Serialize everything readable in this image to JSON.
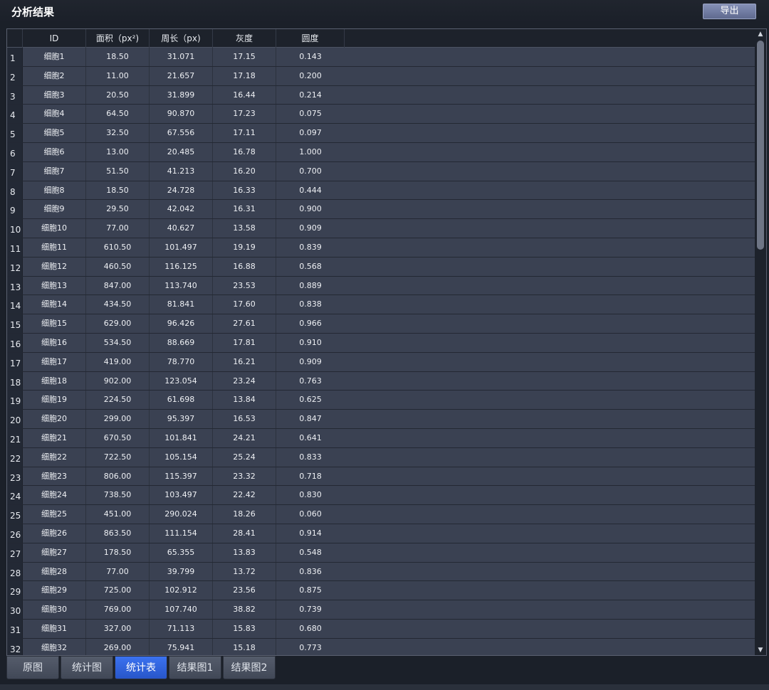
{
  "window": {
    "title": "分析结果"
  },
  "toolbar": {
    "export_label": "导出"
  },
  "table": {
    "columns": [
      "ID",
      "面积（px²)",
      "周长（px)",
      "灰度",
      "圆度"
    ],
    "rows": [
      {
        "n": "1",
        "id": "细胞1",
        "area": "18.50",
        "perimeter": "31.071",
        "gray": "17.15",
        "roundness": "0.143"
      },
      {
        "n": "2",
        "id": "细胞2",
        "area": "11.00",
        "perimeter": "21.657",
        "gray": "17.18",
        "roundness": "0.200"
      },
      {
        "n": "3",
        "id": "细胞3",
        "area": "20.50",
        "perimeter": "31.899",
        "gray": "16.44",
        "roundness": "0.214"
      },
      {
        "n": "4",
        "id": "细胞4",
        "area": "64.50",
        "perimeter": "90.870",
        "gray": "17.23",
        "roundness": "0.075"
      },
      {
        "n": "5",
        "id": "细胞5",
        "area": "32.50",
        "perimeter": "67.556",
        "gray": "17.11",
        "roundness": "0.097"
      },
      {
        "n": "6",
        "id": "细胞6",
        "area": "13.00",
        "perimeter": "20.485",
        "gray": "16.78",
        "roundness": "1.000"
      },
      {
        "n": "7",
        "id": "细胞7",
        "area": "51.50",
        "perimeter": "41.213",
        "gray": "16.20",
        "roundness": "0.700"
      },
      {
        "n": "8",
        "id": "细胞8",
        "area": "18.50",
        "perimeter": "24.728",
        "gray": "16.33",
        "roundness": "0.444"
      },
      {
        "n": "9",
        "id": "细胞9",
        "area": "29.50",
        "perimeter": "42.042",
        "gray": "16.31",
        "roundness": "0.900"
      },
      {
        "n": "10",
        "id": "细胞10",
        "area": "77.00",
        "perimeter": "40.627",
        "gray": "13.58",
        "roundness": "0.909"
      },
      {
        "n": "11",
        "id": "细胞11",
        "area": "610.50",
        "perimeter": "101.497",
        "gray": "19.19",
        "roundness": "0.839"
      },
      {
        "n": "12",
        "id": "细胞12",
        "area": "460.50",
        "perimeter": "116.125",
        "gray": "16.88",
        "roundness": "0.568"
      },
      {
        "n": "13",
        "id": "细胞13",
        "area": "847.00",
        "perimeter": "113.740",
        "gray": "23.53",
        "roundness": "0.889"
      },
      {
        "n": "14",
        "id": "细胞14",
        "area": "434.50",
        "perimeter": "81.841",
        "gray": "17.60",
        "roundness": "0.838"
      },
      {
        "n": "15",
        "id": "细胞15",
        "area": "629.00",
        "perimeter": "96.426",
        "gray": "27.61",
        "roundness": "0.966"
      },
      {
        "n": "16",
        "id": "细胞16",
        "area": "534.50",
        "perimeter": "88.669",
        "gray": "17.81",
        "roundness": "0.910"
      },
      {
        "n": "17",
        "id": "细胞17",
        "area": "419.00",
        "perimeter": "78.770",
        "gray": "16.21",
        "roundness": "0.909"
      },
      {
        "n": "18",
        "id": "细胞18",
        "area": "902.00",
        "perimeter": "123.054",
        "gray": "23.24",
        "roundness": "0.763"
      },
      {
        "n": "19",
        "id": "细胞19",
        "area": "224.50",
        "perimeter": "61.698",
        "gray": "13.84",
        "roundness": "0.625"
      },
      {
        "n": "20",
        "id": "细胞20",
        "area": "299.00",
        "perimeter": "95.397",
        "gray": "16.53",
        "roundness": "0.847"
      },
      {
        "n": "21",
        "id": "细胞21",
        "area": "670.50",
        "perimeter": "101.841",
        "gray": "24.21",
        "roundness": "0.641"
      },
      {
        "n": "22",
        "id": "细胞22",
        "area": "722.50",
        "perimeter": "105.154",
        "gray": "25.24",
        "roundness": "0.833"
      },
      {
        "n": "23",
        "id": "细胞23",
        "area": "806.00",
        "perimeter": "115.397",
        "gray": "23.32",
        "roundness": "0.718"
      },
      {
        "n": "24",
        "id": "细胞24",
        "area": "738.50",
        "perimeter": "103.497",
        "gray": "22.42",
        "roundness": "0.830"
      },
      {
        "n": "25",
        "id": "细胞25",
        "area": "451.00",
        "perimeter": "290.024",
        "gray": "18.26",
        "roundness": "0.060"
      },
      {
        "n": "26",
        "id": "细胞26",
        "area": "863.50",
        "perimeter": "111.154",
        "gray": "28.41",
        "roundness": "0.914"
      },
      {
        "n": "27",
        "id": "细胞27",
        "area": "178.50",
        "perimeter": "65.355",
        "gray": "13.83",
        "roundness": "0.548"
      },
      {
        "n": "28",
        "id": "细胞28",
        "area": "77.00",
        "perimeter": "39.799",
        "gray": "13.72",
        "roundness": "0.836"
      },
      {
        "n": "29",
        "id": "细胞29",
        "area": "725.00",
        "perimeter": "102.912",
        "gray": "23.56",
        "roundness": "0.875"
      },
      {
        "n": "30",
        "id": "细胞30",
        "area": "769.00",
        "perimeter": "107.740",
        "gray": "38.82",
        "roundness": "0.739"
      },
      {
        "n": "31",
        "id": "细胞31",
        "area": "327.00",
        "perimeter": "71.113",
        "gray": "15.83",
        "roundness": "0.680"
      },
      {
        "n": "32",
        "id": "细胞32",
        "area": "269.00",
        "perimeter": "75.941",
        "gray": "15.18",
        "roundness": "0.773"
      }
    ]
  },
  "scrollbar": {
    "up_icon": "▲",
    "down_icon": "▼"
  },
  "tabs": [
    {
      "label": "原图",
      "active": false
    },
    {
      "label": "统计图",
      "active": false
    },
    {
      "label": "统计表",
      "active": true
    },
    {
      "label": "结果图1",
      "active": false
    },
    {
      "label": "结果图2",
      "active": false
    }
  ],
  "colors": {
    "accent": "#3b72f0",
    "background": "#1b2029",
    "table_bg": "#3a4152"
  }
}
